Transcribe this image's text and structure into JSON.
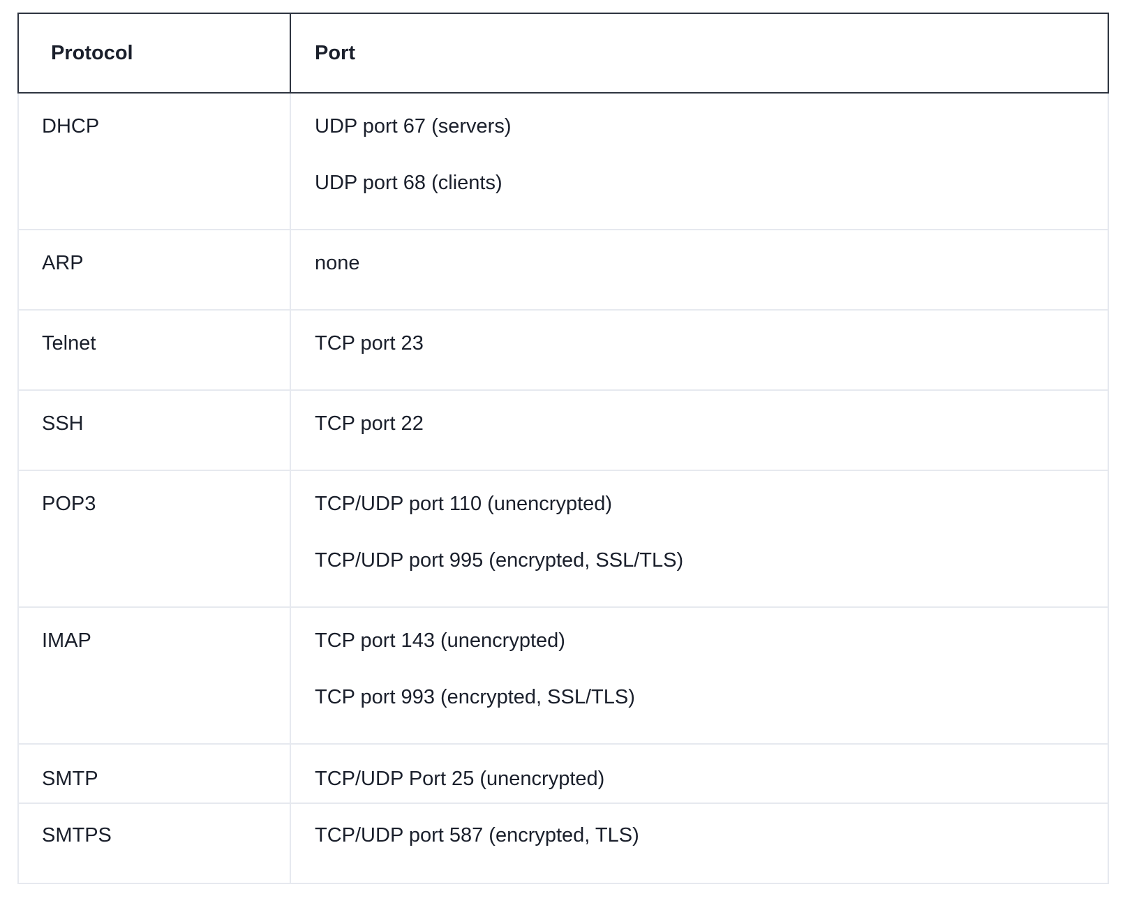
{
  "table": {
    "headers": [
      "Protocol",
      "Port"
    ],
    "rows": [
      {
        "protocol": "DHCP",
        "ports": [
          "UDP port 67 (servers)",
          "UDP port 68 (clients)"
        ]
      },
      {
        "protocol": "ARP",
        "ports": [
          "none"
        ]
      },
      {
        "protocol": "Telnet",
        "ports": [
          "TCP port 23"
        ]
      },
      {
        "protocol": "SSH",
        "ports": [
          "TCP port 22"
        ]
      },
      {
        "protocol": "POP3",
        "ports": [
          "TCP/UDP port 110 (unencrypted)",
          "TCP/UDP port 995 (encrypted, SSL/TLS)"
        ]
      },
      {
        "protocol": "IMAP",
        "ports": [
          "TCP port 143 (unencrypted)",
          "TCP port 993 (encrypted, SSL/TLS)"
        ]
      },
      {
        "protocol": "SMTP",
        "ports": [
          "TCP/UDP Port 25 (unencrypted)"
        ]
      },
      {
        "protocol": "SMTPS",
        "ports": [
          "TCP/UDP port 587 (encrypted, TLS)"
        ]
      }
    ]
  }
}
